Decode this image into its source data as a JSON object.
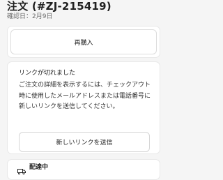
{
  "order": {
    "title": "注文 (#ZJ-215419)",
    "confirmed_date": "確認日：2月9日"
  },
  "rebuy": {
    "button_label": "再購入"
  },
  "link_expired": {
    "heading": "リンクが切れました",
    "body": "ご注文の詳細を表示するには、チェックアウト時に使用したメールアドレスまたは電話番号に新しいリンクを送信してください。",
    "resend_button_label": "新しいリンクを送信"
  },
  "shipping": {
    "icon": "truck-icon",
    "status": "配達中"
  },
  "colors": {
    "background": "#f5f5f5",
    "card": "#ffffff",
    "border": "#d6d6d6",
    "text": "#202020",
    "muted_text": "#6b6b6b"
  }
}
